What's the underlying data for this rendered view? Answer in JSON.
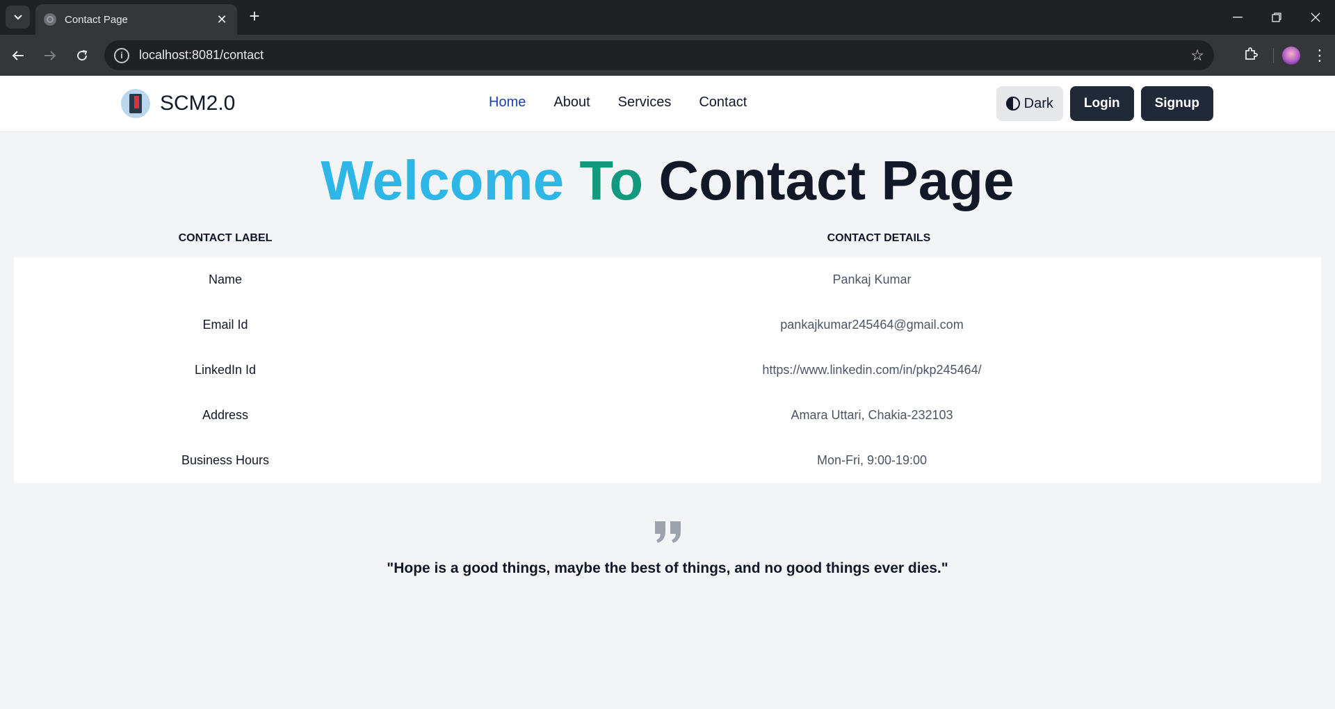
{
  "browser": {
    "tab_title": "Contact Page",
    "url": "localhost:8081/contact"
  },
  "navbar": {
    "brand": "SCM2.0",
    "links": [
      "Home",
      "About",
      "Services",
      "Contact"
    ],
    "active_link": "Home",
    "theme_button": "Dark",
    "login": "Login",
    "signup": "Signup"
  },
  "hero": {
    "word1": "Welcome",
    "word2": "To",
    "word3": "Contact Page"
  },
  "table": {
    "headers": [
      "Contact Label",
      "Contact Details"
    ],
    "rows": [
      {
        "label": "Name",
        "value": "Pankaj Kumar"
      },
      {
        "label": "Email Id",
        "value": "pankajkumar245464@gmail.com"
      },
      {
        "label": "LinkedIn Id",
        "value": "https://www.linkedin.com/in/pkp245464/"
      },
      {
        "label": "Address",
        "value": "Amara Uttari, Chakia-232103"
      },
      {
        "label": "Business Hours",
        "value": "Mon-Fri, 9:00-19:00"
      }
    ]
  },
  "quote": {
    "text": "\"Hope is a good things, maybe the best of things, and no good things ever dies.\""
  },
  "colors": {
    "welcome": "#2db6e6",
    "to": "#139a7e",
    "heading": "#111827",
    "active_link": "#1e40af",
    "button_bg": "#1f2937"
  }
}
